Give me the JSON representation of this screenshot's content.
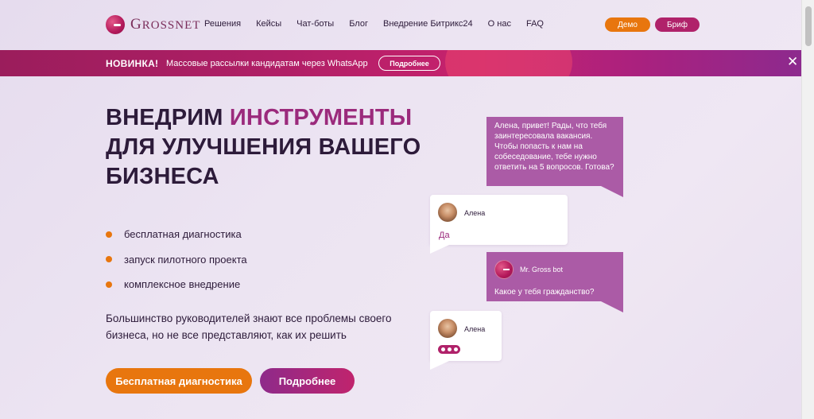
{
  "header": {
    "logo_initial": "G",
    "logo_rest": "ROSSNET",
    "nav": [
      "Решения",
      "Кейсы",
      "Чат-боты",
      "Блог",
      "Внедрение Битрикс24",
      "О нас",
      "FAQ"
    ],
    "demo_label": "Демо",
    "brief_label": "Бриф"
  },
  "banner": {
    "badge": "НОВИНКА!",
    "text": "Массовые рассылки кандидатам через WhatsApp",
    "more_label": "Подробнее",
    "close_glyph": "✕"
  },
  "hero": {
    "title_part1": "ВНЕДРИМ ",
    "title_accent": "ИНСТРУМЕНТЫ",
    "title_part2": "ДЛЯ УЛУЧШЕНИЯ ВАШЕГО БИЗНЕСА",
    "features": [
      "бесплатная диагностика",
      "запуск пилотного проекта",
      "комплексное внедрение"
    ],
    "description": "Большинство руководителей знают все проблемы своего бизнеса, но не все представляют, как их решить",
    "cta_primary": "Бесплатная диагностика",
    "cta_secondary": "Подробнее"
  },
  "chat": {
    "bot_message_1": "Алена, привет! Рады, что тебя заинтересовала вакансия. Чтобы попасть к нам на собеседование, тебе нужно ответить на 5 вопросов. Готова?",
    "user_name": "Алена",
    "user_answer": "Да",
    "bot_name": "Mr. Gross bot",
    "bot_message_2": "Какое у тебя гражданство?"
  },
  "colors": {
    "accent_orange": "#e8760e",
    "accent_magenta": "#b0226a",
    "accent_purple": "#9b2a7c",
    "bot_bubble": "#ab5ba6"
  },
  "icons": [
    "grossnet-logo-icon",
    "close-icon",
    "avatar-icon",
    "bot-avatar-icon",
    "typing-indicator-icon"
  ]
}
